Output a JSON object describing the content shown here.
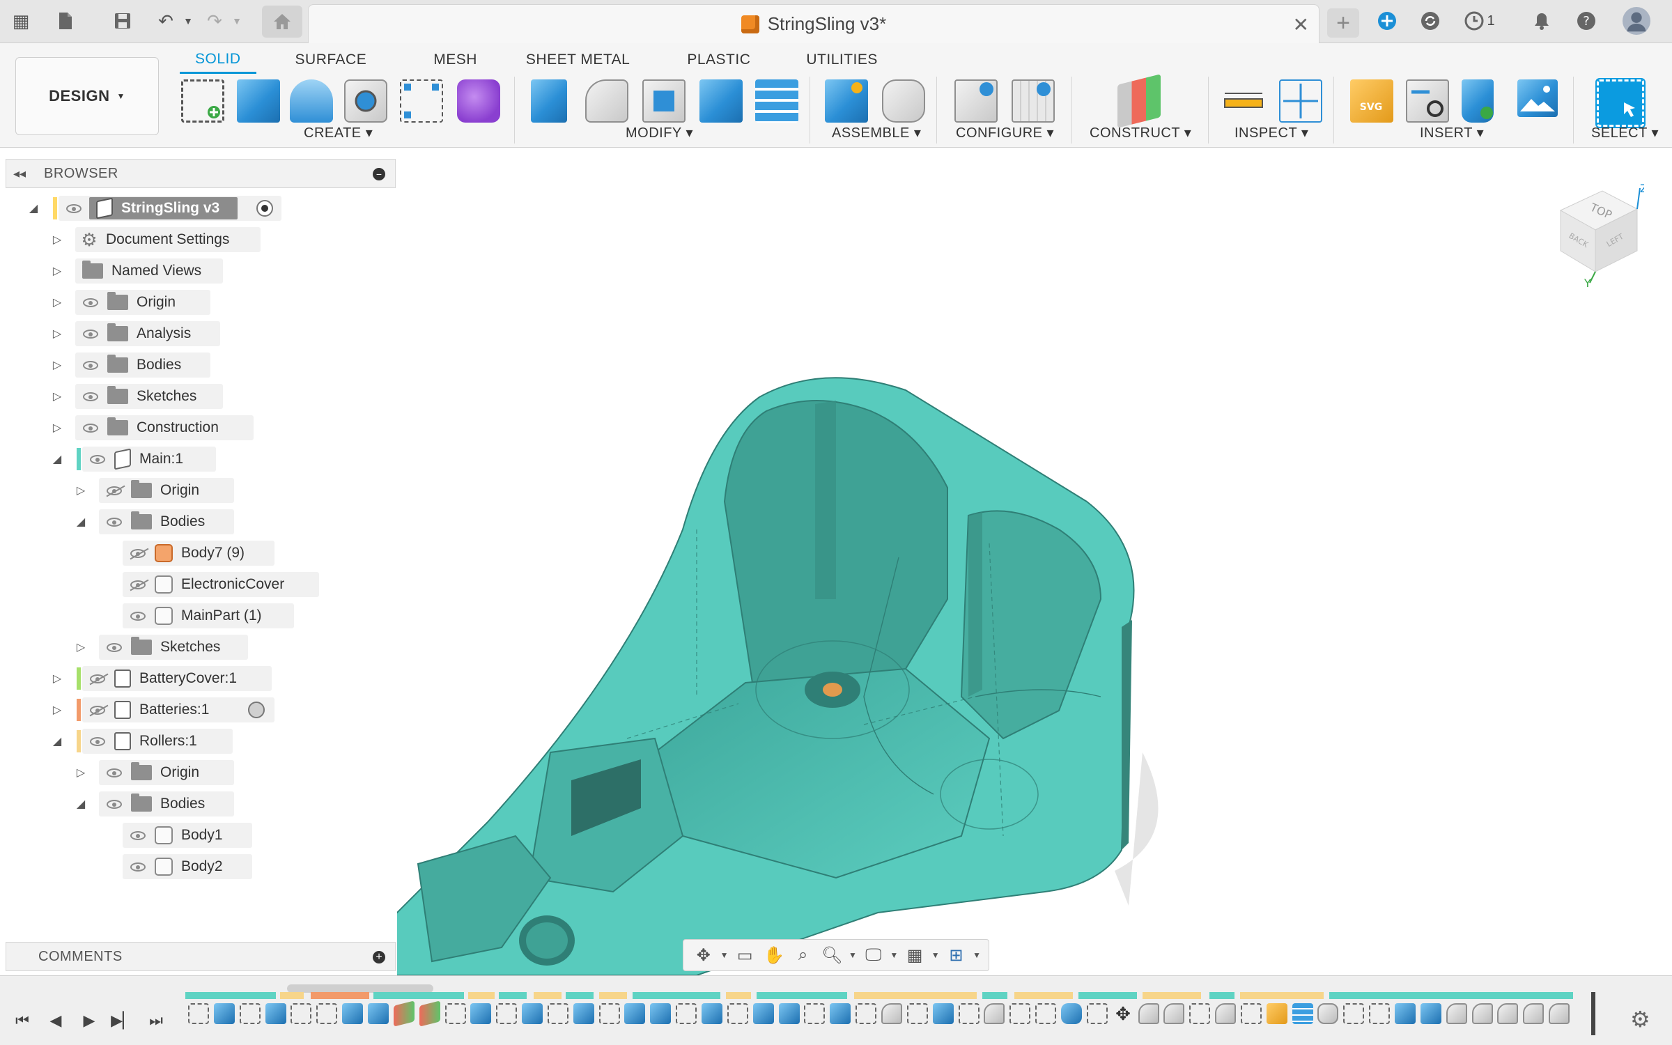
{
  "titlebar": {
    "document_title": "StringSling v3*",
    "notifications_count": "1"
  },
  "workspace": {
    "label": "DESIGN"
  },
  "tabs": [
    {
      "label": "SOLID",
      "active": true
    },
    {
      "label": "SURFACE"
    },
    {
      "label": "MESH"
    },
    {
      "label": "SHEET METAL"
    },
    {
      "label": "PLASTIC"
    },
    {
      "label": "UTILITIES"
    }
  ],
  "groups": {
    "create": "CREATE",
    "modify": "MODIFY",
    "assemble": "ASSEMBLE",
    "configure": "CONFIGURE",
    "construct": "CONSTRUCT",
    "inspect": "INSPECT",
    "insert": "INSERT",
    "select": "SELECT"
  },
  "browser": {
    "title": "BROWSER",
    "items": [
      {
        "label": "StringSling v3"
      },
      {
        "label": "Document Settings"
      },
      {
        "label": "Named Views"
      },
      {
        "label": "Origin"
      },
      {
        "label": "Analysis"
      },
      {
        "label": "Bodies"
      },
      {
        "label": "Sketches"
      },
      {
        "label": "Construction"
      },
      {
        "label": "Main:1"
      },
      {
        "label": "Origin"
      },
      {
        "label": "Bodies"
      },
      {
        "label": "Body7 (9)"
      },
      {
        "label": "ElectronicCover"
      },
      {
        "label": "MainPart (1)"
      },
      {
        "label": "Sketches"
      },
      {
        "label": "BatteryCover:1"
      },
      {
        "label": "Batteries:1"
      },
      {
        "label": "Rollers:1"
      },
      {
        "label": "Origin"
      },
      {
        "label": "Bodies"
      },
      {
        "label": "Body1"
      },
      {
        "label": "Body2"
      }
    ]
  },
  "comments": {
    "title": "COMMENTS"
  },
  "viewcube": {
    "top": "TOP",
    "back": "BACK",
    "left": "LEFT",
    "axis_z": "Z",
    "axis_y": "Y"
  },
  "colors": {
    "accent": "#0696d7",
    "model": "#5fd3c3",
    "model_edge": "#2d7e75",
    "main_bar": "#5fd3c3",
    "battery_cover_bar": "#a6e06a",
    "batteries_bar": "#f29a6a",
    "rollers_bar": "#f7d58a"
  }
}
